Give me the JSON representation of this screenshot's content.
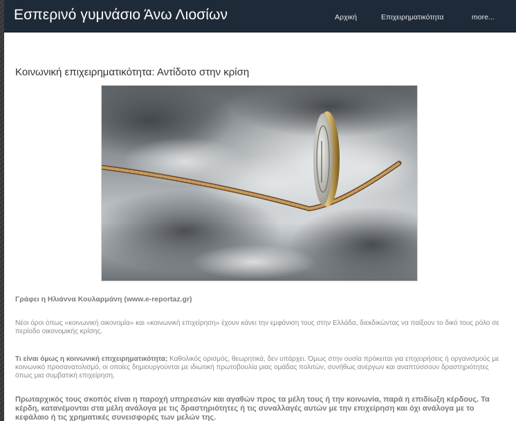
{
  "header": {
    "site_title": "Εσπερινό γυμνάσιο Άνω Λιοσίων",
    "nav": [
      {
        "label": "Αρχική"
      },
      {
        "label": "Επιχειρηματικότητα"
      },
      {
        "label": "more..."
      }
    ]
  },
  "article": {
    "title": "Κοινωνική επιχειρηματικότητα: Αντίδοτο στην κρίση",
    "image": {
      "icon": "euro-coin-on-rope-image"
    },
    "byline": "Γράφει η Ηλιάννα Κουλαρμάνη (www.e-reportaz.gr)",
    "paragraph1": "Νέοι όροι όπως «κοινωνική οικονομία» και «κοινωνική επιχείρηση» έχουν κάνει την εμφάνιση τους στην Ελλάδα, διεκδικώντας να παίξουν το δικό τους ρόλο σε περίοδο οικονομικής κρίσης.",
    "paragraph2_lead": "Τι είναι όμως η κοινωνική επιχειρηματικότητα;",
    "paragraph2_rest": " Καθολικός ορισμός, θεωρητικά, δεν υπάρχει. Όμως στην ουσία πρόκειται για επιχειρήσεις ή οργανισμούς με κοινωνικό προσανατολισμό, οι οποίες δημιουργούνται με ιδιωτική πρωτοβουλία μιας ομάδας πολιτών, συνήθως ανέργων και αναπτύσσουν δραστηριότητες όπως μια συμβατική επιχείρηση.",
    "paragraph3": "Πρωταρχικός τους σκοπός είναι η παροχή υπηρεσιών και αγαθών προς τα μέλη τους ή την κοινωνία, παρά η επιδίωξη κέρδους. Τα κέρδη, κατανέμονται στα μέλη ανάλογα με τις δραστηριότητες ή τις συναλλαγές αυτών με την επιχείρηση και όχι ανάλογα με το κεφάλαιο ή τις χρηματικές συνεισφορές των μελών της."
  },
  "colors": {
    "header_bg": "#1f2a38",
    "page_bg": "#ffffff",
    "body_text": "#8a8a8a"
  }
}
